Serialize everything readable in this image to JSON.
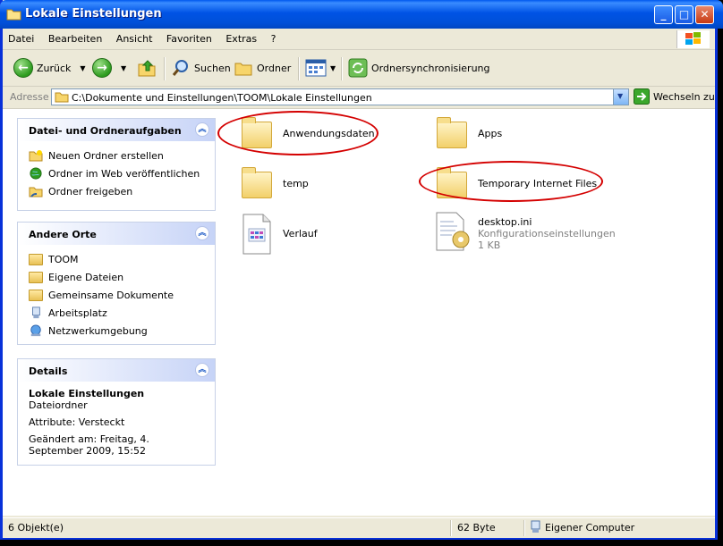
{
  "window": {
    "title": "Lokale Einstellungen",
    "accent": "#0054E3"
  },
  "menu": {
    "items": [
      "Datei",
      "Bearbeiten",
      "Ansicht",
      "Favoriten",
      "Extras",
      "?"
    ]
  },
  "toolbar": {
    "back_label": "Zurück",
    "search_label": "Suchen",
    "folders_label": "Ordner",
    "sync_label": "Ordnersynchronisierung"
  },
  "address": {
    "label": "Adresse",
    "path": "C:\\Dokumente und Einstellungen\\TOOM\\Lokale Einstellungen",
    "go_label": "Wechseln zu"
  },
  "tasks_panel": {
    "title": "Datei- und Ordneraufgaben",
    "items": [
      "Neuen Ordner erstellen",
      "Ordner im Web veröffentlichen",
      "Ordner freigeben"
    ]
  },
  "places_panel": {
    "title": "Andere Orte",
    "items": [
      "TOOM",
      "Eigene Dateien",
      "Gemeinsame Dokumente",
      "Arbeitsplatz",
      "Netzwerkumgebung"
    ]
  },
  "details_panel": {
    "title": "Details",
    "name": "Lokale Einstellungen",
    "type": "Dateiordner",
    "attributes": "Attribute: Versteckt",
    "modified": "Geändert am: Freitag, 4. September 2009, 15:52"
  },
  "files": [
    {
      "name": "Anwendungsdaten",
      "kind": "folder",
      "highlighted": true
    },
    {
      "name": "Apps",
      "kind": "folder",
      "highlighted": false
    },
    {
      "name": "temp",
      "kind": "folder",
      "highlighted": false
    },
    {
      "name": "Temporary Internet Files",
      "kind": "folder",
      "highlighted": true
    },
    {
      "name": "Verlauf",
      "kind": "history",
      "highlighted": false
    },
    {
      "name": "desktop.ini",
      "kind": "config",
      "description": "Konfigurationseinstellungen",
      "size": "1 KB",
      "highlighted": false
    }
  ],
  "status": {
    "count": "6 Objekt(e)",
    "size": "62 Byte",
    "location": "Eigener Computer"
  }
}
